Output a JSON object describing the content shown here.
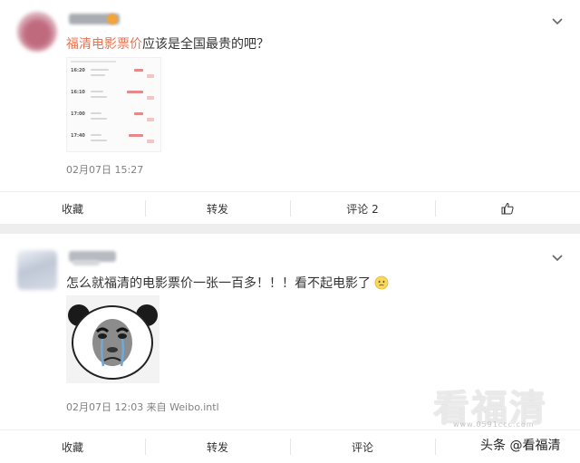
{
  "posts": [
    {
      "hashtag": "福清电影票价",
      "text_rest": "应该是全国最贵的吧？",
      "thumbnail_rows": [
        "16:20",
        "16:10",
        "17:00",
        "17:40"
      ],
      "time": "02月07日 15:27",
      "actions": [
        "收藏",
        "转发",
        "评论 2",
        ""
      ]
    },
    {
      "text": "怎么就福清的电影票价一张一百多！！！看不起电影了",
      "time": "02月07日 12:03 来自 Weibo.intl",
      "actions": [
        "收藏",
        "转发",
        "评论",
        ""
      ]
    }
  ],
  "watermark": {
    "site": "看福清",
    "url": "www.0591ccc.com",
    "toutiao": "头条 @看福清"
  },
  "colors": {
    "hashtag": "#eb7350",
    "card": "#ffffff",
    "background": "#eeeeee"
  }
}
